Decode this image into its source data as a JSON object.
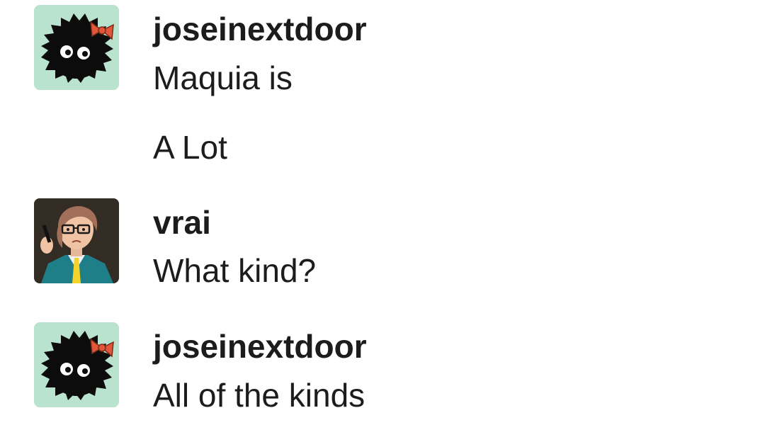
{
  "messages": [
    {
      "author": "joseinextdoor",
      "avatar_icon": "soot-sprite-with-bow-icon",
      "lines": [
        "Maquia is",
        "A Lot"
      ]
    },
    {
      "author": "vrai",
      "avatar_icon": "illustrated-person-with-glasses-icon",
      "lines": [
        "What kind?"
      ]
    },
    {
      "author": "joseinextdoor",
      "avatar_icon": "soot-sprite-with-bow-icon",
      "lines": [
        "All of the kinds"
      ]
    }
  ],
  "colors": {
    "soot_avatar_bg": "#b9e3cf",
    "bow": "#e0573a",
    "text": "#1d1c1d"
  }
}
